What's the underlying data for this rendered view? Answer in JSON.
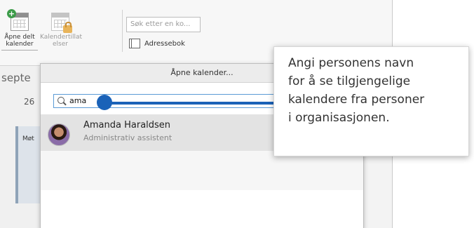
{
  "ribbon": {
    "open_shared_label_line1": "Åpne delt",
    "open_shared_label_line2": "kalender",
    "permissions_label_line1": "Kalendertillat",
    "permissions_label_line2": "elser",
    "search_placeholder": "Søk etter en ko...",
    "address_book_label": "Adressebok"
  },
  "calendar": {
    "month_fragment": "septe",
    "day_number": "26",
    "event_fragment": "Møt"
  },
  "dialog": {
    "title": "Åpne kalender...",
    "search_value": "ama",
    "results": [
      {
        "name": "Amanda Haraldsen",
        "title": "Administrativ assistent"
      }
    ]
  },
  "callout": {
    "text_lines": [
      "Angi personens navn",
      "for å se tilgjengelige",
      "kalendere fra personer",
      "i organisasjonen."
    ]
  },
  "colors": {
    "accent": "#1a62b8",
    "focus": "#5b9bd5"
  },
  "icons": [
    "add-calendar-icon",
    "calendar-permissions-icon",
    "address-book-icon",
    "search-icon"
  ]
}
